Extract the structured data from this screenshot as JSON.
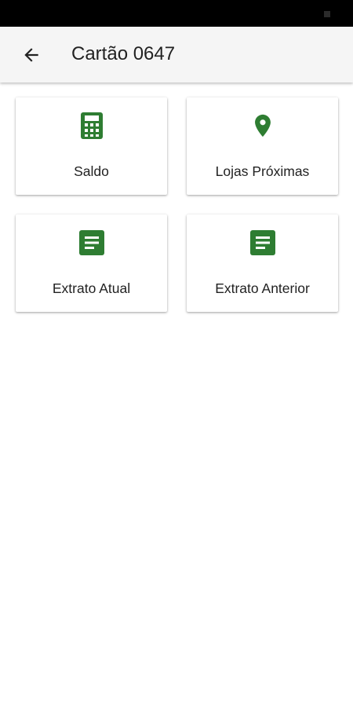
{
  "theme": {
    "accent": "#2e7d32",
    "app_bar_bg": "#f5f5f5",
    "status_bar_bg": "#000000"
  },
  "header": {
    "title": "Cartão 0647",
    "back_icon": "arrow-back-icon"
  },
  "menu": {
    "items": [
      {
        "label": "Saldo",
        "icon": "calculator-icon"
      },
      {
        "label": "Lojas Próximas",
        "icon": "location-pin-icon"
      },
      {
        "label": "Extrato Atual",
        "icon": "document-icon"
      },
      {
        "label": "Extrato Anterior",
        "icon": "document-icon"
      }
    ]
  }
}
